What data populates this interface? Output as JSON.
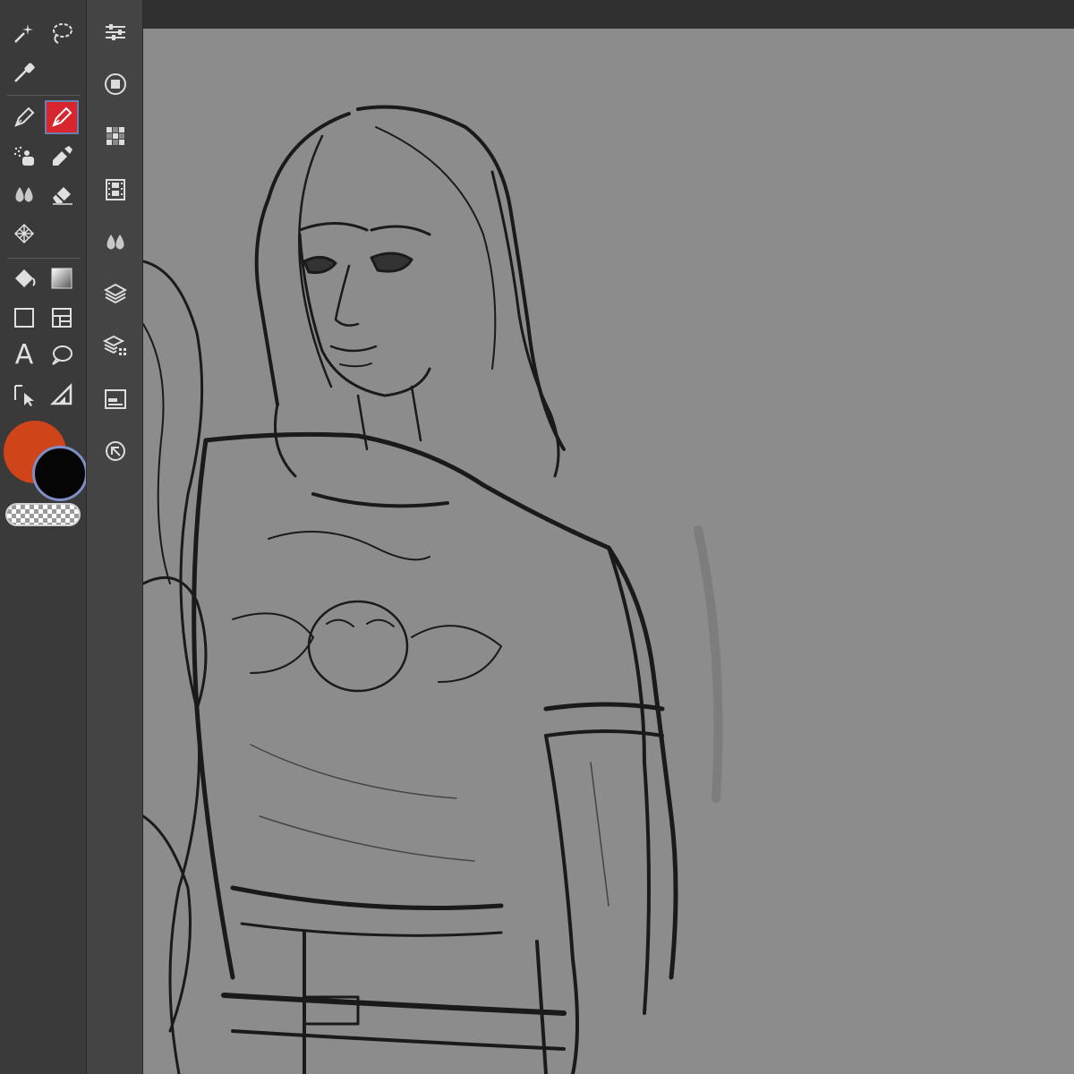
{
  "colors": {
    "main_color": "#cf4418",
    "sub_color": "#050505",
    "canvas_bg": "#8c8c8c",
    "active_tool_bg": "#d8262e"
  },
  "toolbox": {
    "tools": [
      {
        "name": "auto-select-icon"
      },
      {
        "name": "lasso-select-icon"
      },
      {
        "name": "eyedropper-icon"
      },
      {
        "name": "pen-icon"
      },
      {
        "name": "pen-active-icon",
        "active": true
      },
      {
        "name": "airbrush-icon"
      },
      {
        "name": "brush-icon"
      },
      {
        "name": "blend-icon"
      },
      {
        "name": "eraser-icon"
      },
      {
        "name": "decoration-icon"
      },
      {
        "name": "fill-icon"
      },
      {
        "name": "gradient-icon"
      },
      {
        "name": "figure-icon"
      },
      {
        "name": "frame-border-icon"
      },
      {
        "name": "text-icon",
        "glyph": "A"
      },
      {
        "name": "balloon-icon"
      },
      {
        "name": "object-select-icon"
      },
      {
        "name": "ruler-icon"
      }
    ]
  },
  "palette_bar": {
    "buttons": [
      "tool-property-icon",
      "color-circle-icon",
      "color-set-icon",
      "timeline-icon",
      "sub-tool-icon",
      "layer-icon",
      "layer-property-icon",
      "navigator-icon",
      "history-icon"
    ]
  }
}
